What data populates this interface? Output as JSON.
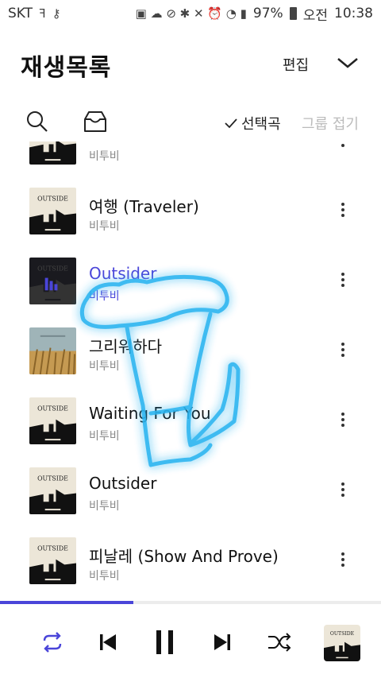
{
  "status_bar": {
    "carrier": "SKT",
    "icons_left": [
      "f-icon",
      "key-icon"
    ],
    "battery": "97%",
    "time_prefix": "오전",
    "time": "10:38"
  },
  "header": {
    "title": "재생목록",
    "edit": "편집"
  },
  "toolbar": {
    "select_songs": "선택곡",
    "fold_groups": "그룹 접기"
  },
  "songs": [
    {
      "title": "",
      "artist": "비투비",
      "cover": "outside",
      "active": false
    },
    {
      "title": "여행 (Traveler)",
      "artist": "비투비",
      "cover": "outside",
      "active": false
    },
    {
      "title": "Outsider",
      "artist": "비투비",
      "cover": "outside-dark",
      "active": true
    },
    {
      "title": "그리워하다",
      "artist": "비투비",
      "cover": "field",
      "active": false
    },
    {
      "title": "Waiting For You",
      "artist": "비투비",
      "cover": "outside",
      "active": false
    },
    {
      "title": "Outsider",
      "artist": "비투비",
      "cover": "outside",
      "active": false
    },
    {
      "title": "피날레 (Show And Prove)",
      "artist": "비투비",
      "cover": "outside",
      "active": false
    }
  ],
  "album_text": "OUTSIDE",
  "playback": {
    "progress_fraction": 0.35,
    "accent_color": "#4a45d9",
    "controls": [
      "repeat-icon",
      "previous-icon",
      "pause-icon",
      "next-icon",
      "shuffle-icon"
    ]
  }
}
